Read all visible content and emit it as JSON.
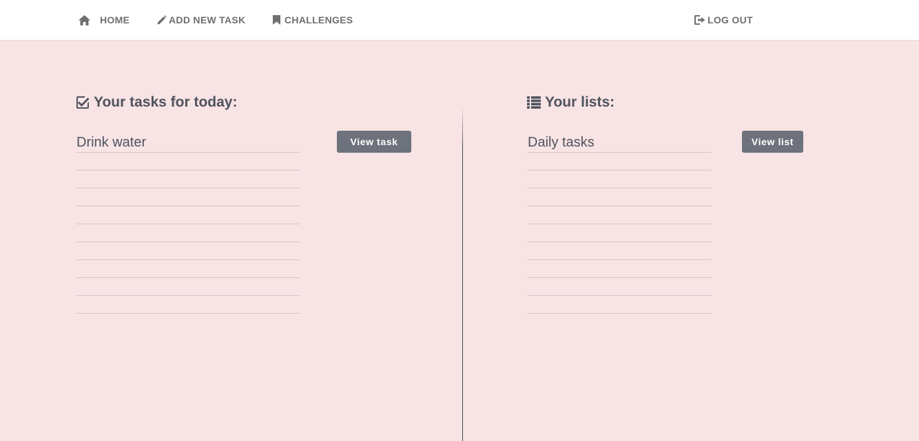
{
  "nav": {
    "home": {
      "label": "HOME",
      "icon": "home-icon"
    },
    "add_task": {
      "label": "ADD NEW TASK",
      "icon": "pencil-icon"
    },
    "challenges": {
      "label": "CHALLENGES",
      "icon": "bookmark-icon"
    },
    "logout": {
      "label": "LOG OUT",
      "icon": "logout-icon"
    }
  },
  "tasks": {
    "title": "Your tasks for today:",
    "icon": "checkbox-icon",
    "items": [
      "Drink water",
      "",
      "",
      "",
      "",
      "",
      "",
      "",
      "",
      ""
    ],
    "button_label": "View task"
  },
  "lists": {
    "title": "Your lists:",
    "icon": "list-icon",
    "items": [
      "Daily tasks",
      "",
      "",
      "",
      "",
      "",
      "",
      "",
      "",
      ""
    ],
    "button_label": "View list"
  },
  "colors": {
    "background": "#f8e4e4",
    "navbar": "#ffffff",
    "button": "#6e727d",
    "text": "#4f535f"
  }
}
